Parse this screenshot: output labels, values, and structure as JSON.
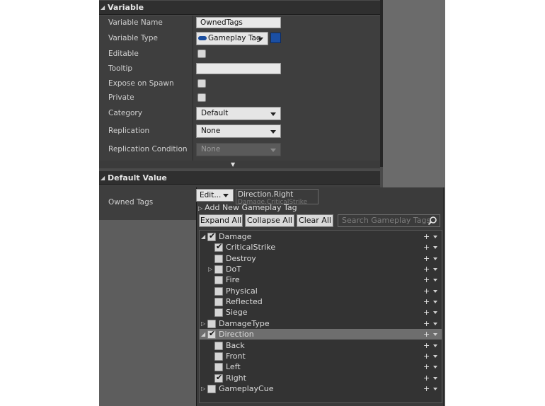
{
  "variable_section": {
    "title": "Variable",
    "rows": {
      "name_label": "Variable Name",
      "name_value": "OwnedTags",
      "type_label": "Variable Type",
      "type_value": "Gameplay Tag",
      "editable_label": "Editable",
      "tooltip_label": "Tooltip",
      "tooltip_value": "",
      "expose_label": "Expose on Spawn",
      "private_label": "Private",
      "category_label": "Category",
      "category_value": "Default",
      "replication_label": "Replication",
      "replication_value": "None",
      "repcond_label": "Replication Condition",
      "repcond_value": "None"
    }
  },
  "default_section": {
    "title": "Default Value",
    "owned_tags_label": "Owned Tags",
    "edit_button": "Edit...",
    "current_tags": [
      "Direction.Right",
      "Damage.CriticalStrike"
    ]
  },
  "tag_picker": {
    "add_new": "Add New Gameplay Tag",
    "expand_all": "Expand All",
    "collapse_all": "Collapse All",
    "clear_all": "Clear All",
    "search_placeholder": "Search Gameplay Tags",
    "tree": [
      {
        "name": "Damage",
        "checked": true,
        "expanded": true,
        "level": 0
      },
      {
        "name": "CriticalStrike",
        "checked": true,
        "level": 1
      },
      {
        "name": "Destroy",
        "checked": false,
        "level": 1
      },
      {
        "name": "DoT",
        "checked": false,
        "level": 1,
        "collapsed_children": true
      },
      {
        "name": "Fire",
        "checked": false,
        "level": 1
      },
      {
        "name": "Physical",
        "checked": false,
        "level": 1
      },
      {
        "name": "Reflected",
        "checked": false,
        "level": 1
      },
      {
        "name": "Siege",
        "checked": false,
        "level": 1
      },
      {
        "name": "DamageType",
        "checked": false,
        "level": 0,
        "collapsed_children": true
      },
      {
        "name": "Direction",
        "checked": true,
        "expanded": true,
        "level": 0,
        "selected": true
      },
      {
        "name": "Back",
        "checked": false,
        "level": 1
      },
      {
        "name": "Front",
        "checked": false,
        "level": 1
      },
      {
        "name": "Left",
        "checked": false,
        "level": 1
      },
      {
        "name": "Right",
        "checked": true,
        "level": 1
      },
      {
        "name": "GameplayCue",
        "checked": false,
        "level": 0,
        "collapsed_children": true
      }
    ]
  },
  "colors": {
    "type_pill": "#1a4d9e",
    "panel_bg": "#4a4a4a",
    "selected_row": "#6e6e6e"
  }
}
